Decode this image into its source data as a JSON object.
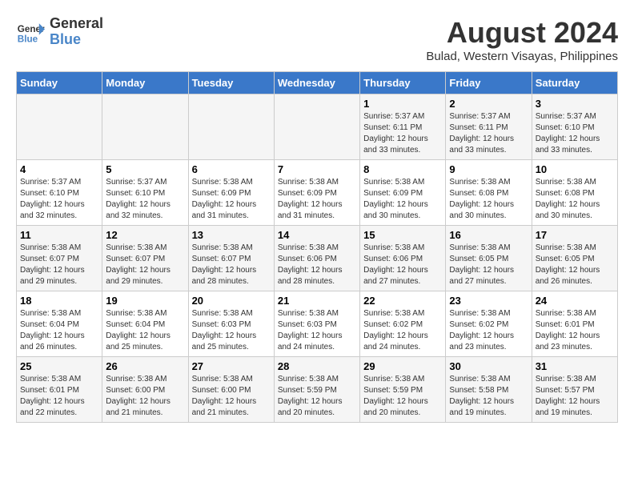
{
  "header": {
    "logo_line1": "General",
    "logo_line2": "Blue",
    "month_year": "August 2024",
    "location": "Bulad, Western Visayas, Philippines"
  },
  "days_of_week": [
    "Sunday",
    "Monday",
    "Tuesday",
    "Wednesday",
    "Thursday",
    "Friday",
    "Saturday"
  ],
  "weeks": [
    [
      {
        "day": "",
        "sunrise": "",
        "sunset": "",
        "daylight": ""
      },
      {
        "day": "",
        "sunrise": "",
        "sunset": "",
        "daylight": ""
      },
      {
        "day": "",
        "sunrise": "",
        "sunset": "",
        "daylight": ""
      },
      {
        "day": "",
        "sunrise": "",
        "sunset": "",
        "daylight": ""
      },
      {
        "day": "1",
        "sunrise": "5:37 AM",
        "sunset": "6:11 PM",
        "daylight": "12 hours and 33 minutes."
      },
      {
        "day": "2",
        "sunrise": "5:37 AM",
        "sunset": "6:11 PM",
        "daylight": "12 hours and 33 minutes."
      },
      {
        "day": "3",
        "sunrise": "5:37 AM",
        "sunset": "6:10 PM",
        "daylight": "12 hours and 33 minutes."
      }
    ],
    [
      {
        "day": "4",
        "sunrise": "5:37 AM",
        "sunset": "6:10 PM",
        "daylight": "12 hours and 32 minutes."
      },
      {
        "day": "5",
        "sunrise": "5:37 AM",
        "sunset": "6:10 PM",
        "daylight": "12 hours and 32 minutes."
      },
      {
        "day": "6",
        "sunrise": "5:38 AM",
        "sunset": "6:09 PM",
        "daylight": "12 hours and 31 minutes."
      },
      {
        "day": "7",
        "sunrise": "5:38 AM",
        "sunset": "6:09 PM",
        "daylight": "12 hours and 31 minutes."
      },
      {
        "day": "8",
        "sunrise": "5:38 AM",
        "sunset": "6:09 PM",
        "daylight": "12 hours and 30 minutes."
      },
      {
        "day": "9",
        "sunrise": "5:38 AM",
        "sunset": "6:08 PM",
        "daylight": "12 hours and 30 minutes."
      },
      {
        "day": "10",
        "sunrise": "5:38 AM",
        "sunset": "6:08 PM",
        "daylight": "12 hours and 30 minutes."
      }
    ],
    [
      {
        "day": "11",
        "sunrise": "5:38 AM",
        "sunset": "6:07 PM",
        "daylight": "12 hours and 29 minutes."
      },
      {
        "day": "12",
        "sunrise": "5:38 AM",
        "sunset": "6:07 PM",
        "daylight": "12 hours and 29 minutes."
      },
      {
        "day": "13",
        "sunrise": "5:38 AM",
        "sunset": "6:07 PM",
        "daylight": "12 hours and 28 minutes."
      },
      {
        "day": "14",
        "sunrise": "5:38 AM",
        "sunset": "6:06 PM",
        "daylight": "12 hours and 28 minutes."
      },
      {
        "day": "15",
        "sunrise": "5:38 AM",
        "sunset": "6:06 PM",
        "daylight": "12 hours and 27 minutes."
      },
      {
        "day": "16",
        "sunrise": "5:38 AM",
        "sunset": "6:05 PM",
        "daylight": "12 hours and 27 minutes."
      },
      {
        "day": "17",
        "sunrise": "5:38 AM",
        "sunset": "6:05 PM",
        "daylight": "12 hours and 26 minutes."
      }
    ],
    [
      {
        "day": "18",
        "sunrise": "5:38 AM",
        "sunset": "6:04 PM",
        "daylight": "12 hours and 26 minutes."
      },
      {
        "day": "19",
        "sunrise": "5:38 AM",
        "sunset": "6:04 PM",
        "daylight": "12 hours and 25 minutes."
      },
      {
        "day": "20",
        "sunrise": "5:38 AM",
        "sunset": "6:03 PM",
        "daylight": "12 hours and 25 minutes."
      },
      {
        "day": "21",
        "sunrise": "5:38 AM",
        "sunset": "6:03 PM",
        "daylight": "12 hours and 24 minutes."
      },
      {
        "day": "22",
        "sunrise": "5:38 AM",
        "sunset": "6:02 PM",
        "daylight": "12 hours and 24 minutes."
      },
      {
        "day": "23",
        "sunrise": "5:38 AM",
        "sunset": "6:02 PM",
        "daylight": "12 hours and 23 minutes."
      },
      {
        "day": "24",
        "sunrise": "5:38 AM",
        "sunset": "6:01 PM",
        "daylight": "12 hours and 23 minutes."
      }
    ],
    [
      {
        "day": "25",
        "sunrise": "5:38 AM",
        "sunset": "6:01 PM",
        "daylight": "12 hours and 22 minutes."
      },
      {
        "day": "26",
        "sunrise": "5:38 AM",
        "sunset": "6:00 PM",
        "daylight": "12 hours and 21 minutes."
      },
      {
        "day": "27",
        "sunrise": "5:38 AM",
        "sunset": "6:00 PM",
        "daylight": "12 hours and 21 minutes."
      },
      {
        "day": "28",
        "sunrise": "5:38 AM",
        "sunset": "5:59 PM",
        "daylight": "12 hours and 20 minutes."
      },
      {
        "day": "29",
        "sunrise": "5:38 AM",
        "sunset": "5:59 PM",
        "daylight": "12 hours and 20 minutes."
      },
      {
        "day": "30",
        "sunrise": "5:38 AM",
        "sunset": "5:58 PM",
        "daylight": "12 hours and 19 minutes."
      },
      {
        "day": "31",
        "sunrise": "5:38 AM",
        "sunset": "5:57 PM",
        "daylight": "12 hours and 19 minutes."
      }
    ]
  ]
}
